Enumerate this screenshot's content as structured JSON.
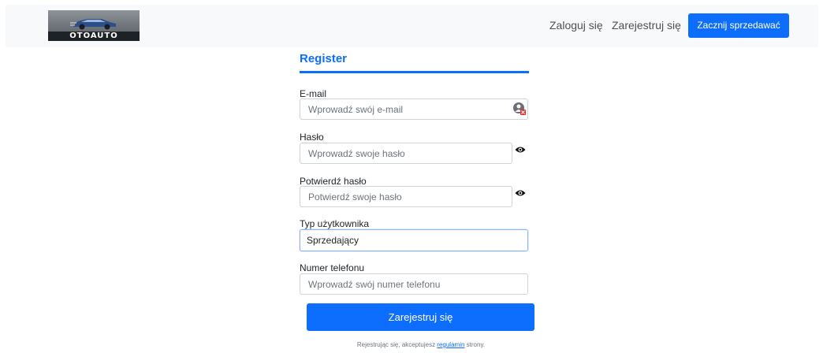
{
  "header": {
    "logo_text": "OTOAUTO",
    "login_label": "Zaloguj się",
    "register_label": "Zarejestruj się",
    "sell_button_label": "Zacznij sprzedawać"
  },
  "form": {
    "title": "Register",
    "email": {
      "label": "E-mail",
      "placeholder": "Wprowadź swój e-mail"
    },
    "password": {
      "label": "Hasło",
      "placeholder": "Wprowadź swoje hasło"
    },
    "confirm_password": {
      "label": "Potwierdź hasło",
      "placeholder": "Potwierdź swoje hasło"
    },
    "user_type": {
      "label": "Typ użytkownika",
      "selected": "Sprzedający"
    },
    "phone": {
      "label": "Numer telefonu",
      "placeholder": "Wprowadź swój numer telefonu"
    },
    "submit_label": "Zarejestruj się",
    "terms_prefix": "Rejestrując się, akceptujesz ",
    "terms_link": "regulamin",
    "terms_suffix": " strony."
  },
  "icons": {
    "password_toggle": "eye-icon",
    "password_manager": "password-manager-icon"
  },
  "colors": {
    "accent": "#0d6efd",
    "navbar_bg": "#f8f9fa",
    "input_border": "#ced4da",
    "focus_border": "#86b7fe"
  }
}
